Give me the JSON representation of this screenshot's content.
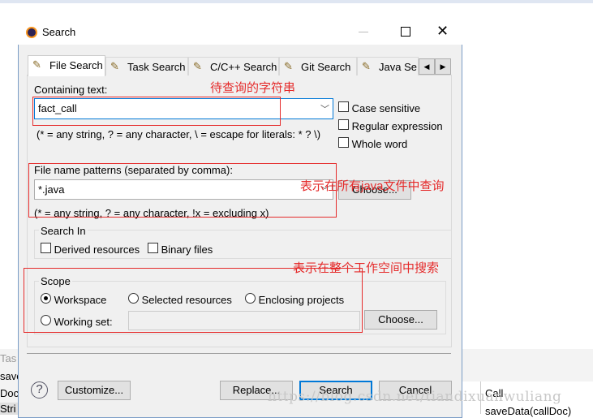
{
  "dialog": {
    "title": "Search",
    "icon": "eclipse-icon"
  },
  "tabs": [
    {
      "label": "File Search",
      "active": true
    },
    {
      "label": "Task Search"
    },
    {
      "label": "C/C++ Search"
    },
    {
      "label": "Git Search"
    },
    {
      "label": "Java Se"
    }
  ],
  "containing": {
    "label": "Containing text:",
    "value": "fact_call",
    "hint": "(* = any string, ? = any character, \\ = escape for literals: * ? \\)"
  },
  "options": {
    "case": "Case sensitive",
    "regex": "Regular expression",
    "whole": "Whole word"
  },
  "patterns": {
    "label": "File name patterns (separated by comma):",
    "value": "*.java",
    "hint": "(* = any string, ? = any character, !x = excluding x)",
    "choose": "Choose..."
  },
  "search_in": {
    "label": "Search In",
    "derived": "Derived resources",
    "binary": "Binary files"
  },
  "scope": {
    "label": "Scope",
    "workspace": "Workspace",
    "selected": "Selected resources",
    "enclosing": "Enclosing projects",
    "working": "Working set:",
    "working_value": "",
    "choose": "Choose...",
    "selected_option": "Workspace"
  },
  "annotations": {
    "a1": "待查询的字符串",
    "a2": "表示在所有java文件中查询",
    "a3": "表示在整个工作空间中搜索"
  },
  "buttons": {
    "customize": "Customize...",
    "replace": "Replace...",
    "search": "Search",
    "cancel": "Cancel"
  },
  "watermark": "https://blog.csdn.net/tiandixuanwuliang",
  "background": {
    "l1": "Tas",
    "l2": "save",
    "l3": "Docu",
    "l4": "Stri",
    "r1": "Call",
    "r2": "saveData(callDoc)"
  }
}
